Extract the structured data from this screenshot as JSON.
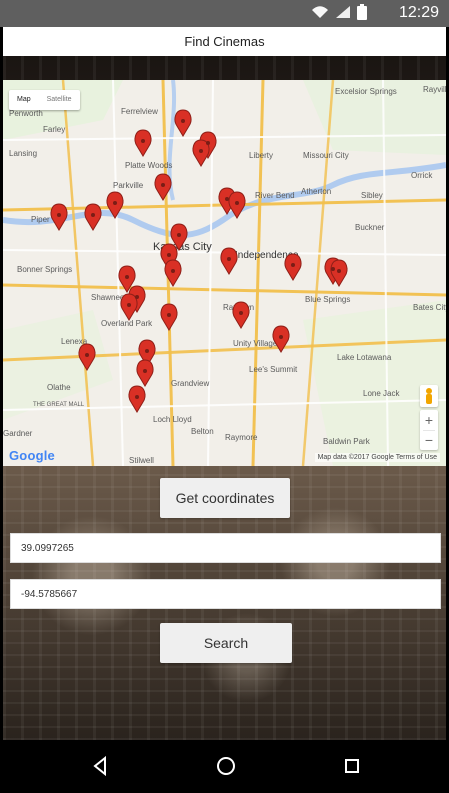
{
  "status_bar": {
    "time": "12:29",
    "icons": [
      "wifi-icon",
      "signal-icon",
      "battery-icon"
    ]
  },
  "app_bar": {
    "title": "Find Cinemas"
  },
  "map": {
    "type_controls": [
      {
        "label": "Map",
        "selected": true
      },
      {
        "label": "Satellite",
        "selected": false
      }
    ],
    "google_logo": "Google",
    "attribution": "Map data ©2017 Google   Terms of Use",
    "place_labels": [
      "Penworth",
      "Farley",
      "Lansing",
      "Piper",
      "Bonner Springs",
      "Shawnee",
      "Overland Park",
      "Lenexa",
      "Olathe",
      "Platte Woods",
      "Parkville",
      "Ferrelview",
      "Kansas City",
      "Liberty",
      "Missouri City",
      "River Bend",
      "Atherton",
      "Sibley",
      "Buckner",
      "Independence",
      "Blue Springs",
      "Bates City",
      "Raytown",
      "Unity Village",
      "Lee's Summit",
      "Grandview",
      "Loch Lloyd",
      "Belton",
      "Raymore",
      "Lake Lotawana",
      "Lone Jack",
      "Baldwin Park",
      "Stilwell",
      "Excelsior Springs",
      "Rayville",
      "Orrick",
      "Gardner",
      "THE GREAT MALL"
    ]
  },
  "coordinates": {
    "button_label": "Get coordinates",
    "latitude_value": "39.0997265",
    "longitude_value": "-94.5785667"
  },
  "search": {
    "button_label": "Search"
  },
  "nav_bar": {
    "back_icon": "back-icon",
    "home_icon": "home-icon",
    "recents_icon": "recents-icon"
  },
  "theme": {
    "status_bar_bg": "#5f5f5f",
    "map_bg": "#f2efe9",
    "pin_color": "#d93025",
    "button_bg": "#efefef"
  }
}
